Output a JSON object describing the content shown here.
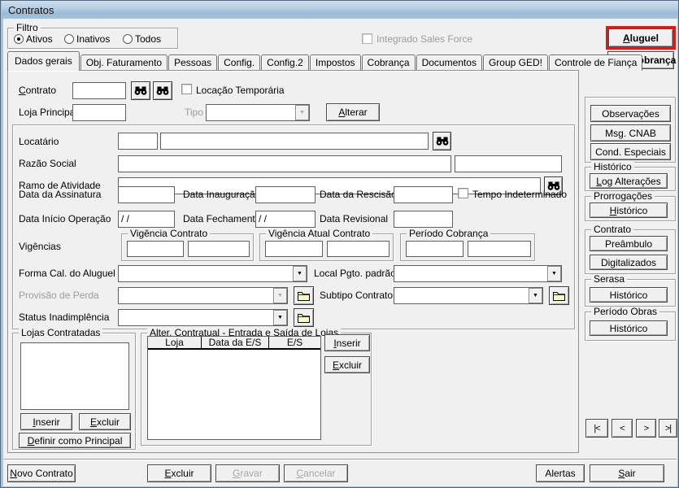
{
  "window": {
    "title": "Contratos"
  },
  "filter": {
    "legend": "Filtro",
    "options": [
      {
        "label": "Ativos",
        "selected": true
      },
      {
        "label": "Inativos",
        "selected": false
      },
      {
        "label": "Todos",
        "selected": false
      }
    ]
  },
  "header": {
    "sales_force_label": "Integrado Sales Force",
    "aluguel_button": "Aluguel",
    "itens_cobranca_button": "Itens Cobrança"
  },
  "tabs": [
    "Dados gerais",
    "Obj. Faturamento",
    "Pessoas",
    "Config.",
    "Config.2",
    "Impostos",
    "Cobrança",
    "Documentos",
    "Group GED!",
    "Controle de Fiança"
  ],
  "active_tab": "Dados gerais",
  "form": {
    "contrato_label": "Contrato",
    "loja_principal_label": "Loja Principal",
    "locacao_temporaria_label": "Locação Temporária",
    "tipo_label": "Tipo",
    "alterar_button": "Alterar",
    "locatario_label": "Locatário",
    "razao_social_label": "Razão Social",
    "ramo_atividade_label": "Ramo de Atividade",
    "data_assinatura_label": "Data da Assinatura",
    "data_inauguracao_label": "Data Inauguração",
    "data_rescisao_label": "Data da Rescisão",
    "tempo_indeterminado_label": "Tempo Indeterminado",
    "data_inicio_operacao_label": "Data Início Operação",
    "data_fechamento_label": "Data Fechamento",
    "data_revisional_label": "Data Revisional",
    "data_inicio_operacao_value": "/ /",
    "data_fechamento_value": "/ /",
    "vigencias_label": "Vigências",
    "vigencia_contrato_legend": "Vigência Contrato",
    "vigencia_atual_legend": "Vigência Atual Contrato",
    "periodo_cobranca_legend": "Período Cobrança",
    "forma_cal_label": "Forma Cal. do Aluguel",
    "local_pgto_label": "Local Pgto. padrão",
    "provisao_perda_label": "Provisão de Perda",
    "subtipo_contrato_label": "Subtipo Contrato",
    "status_inadimplencia_label": "Status Inadimplência"
  },
  "lojas": {
    "legend": "Lojas Contratadas",
    "inserir_button": "Inserir",
    "excluir_button": "Excluir",
    "definir_principal_button": "Definir como Principal"
  },
  "alteracoes": {
    "legend": "Alter. Contratual - Entrada e Saída de Lojas",
    "columns": [
      "Loja",
      "Data da E/S",
      "E/S"
    ],
    "rows": [],
    "inserir_button": "Inserir",
    "excluir_button": "Excluir"
  },
  "sidebar": {
    "buttons_top": [
      "Observações",
      "Msg. CNAB",
      "Cond. Especiais"
    ],
    "groups": [
      {
        "legend": "Histórico",
        "buttons": [
          "Log Alterações"
        ]
      },
      {
        "legend": "Prorrogações",
        "buttons": [
          "Histórico"
        ]
      },
      {
        "legend": "Contrato",
        "buttons": [
          "Preâmbulo",
          "Digitalizados"
        ]
      },
      {
        "legend": "Serasa",
        "buttons": [
          "Histórico"
        ]
      },
      {
        "legend": "Período Obras",
        "buttons": [
          "Histórico"
        ]
      }
    ],
    "nav": [
      "|<",
      "<",
      ">",
      ">|"
    ]
  },
  "footer": {
    "novo_contrato_button": "Novo Contrato",
    "excluir_button": "Excluir",
    "gravar_button": "Gravar",
    "cancelar_button": "Cancelar",
    "alertas_button": "Alertas",
    "sair_button": "Sair"
  },
  "colors": {
    "annotation_red": "#d81b1b",
    "titlebar_blue": "#9cb9d4",
    "folder_yellow": "#fffcc0",
    "background_gray": "#f0f0f0"
  }
}
